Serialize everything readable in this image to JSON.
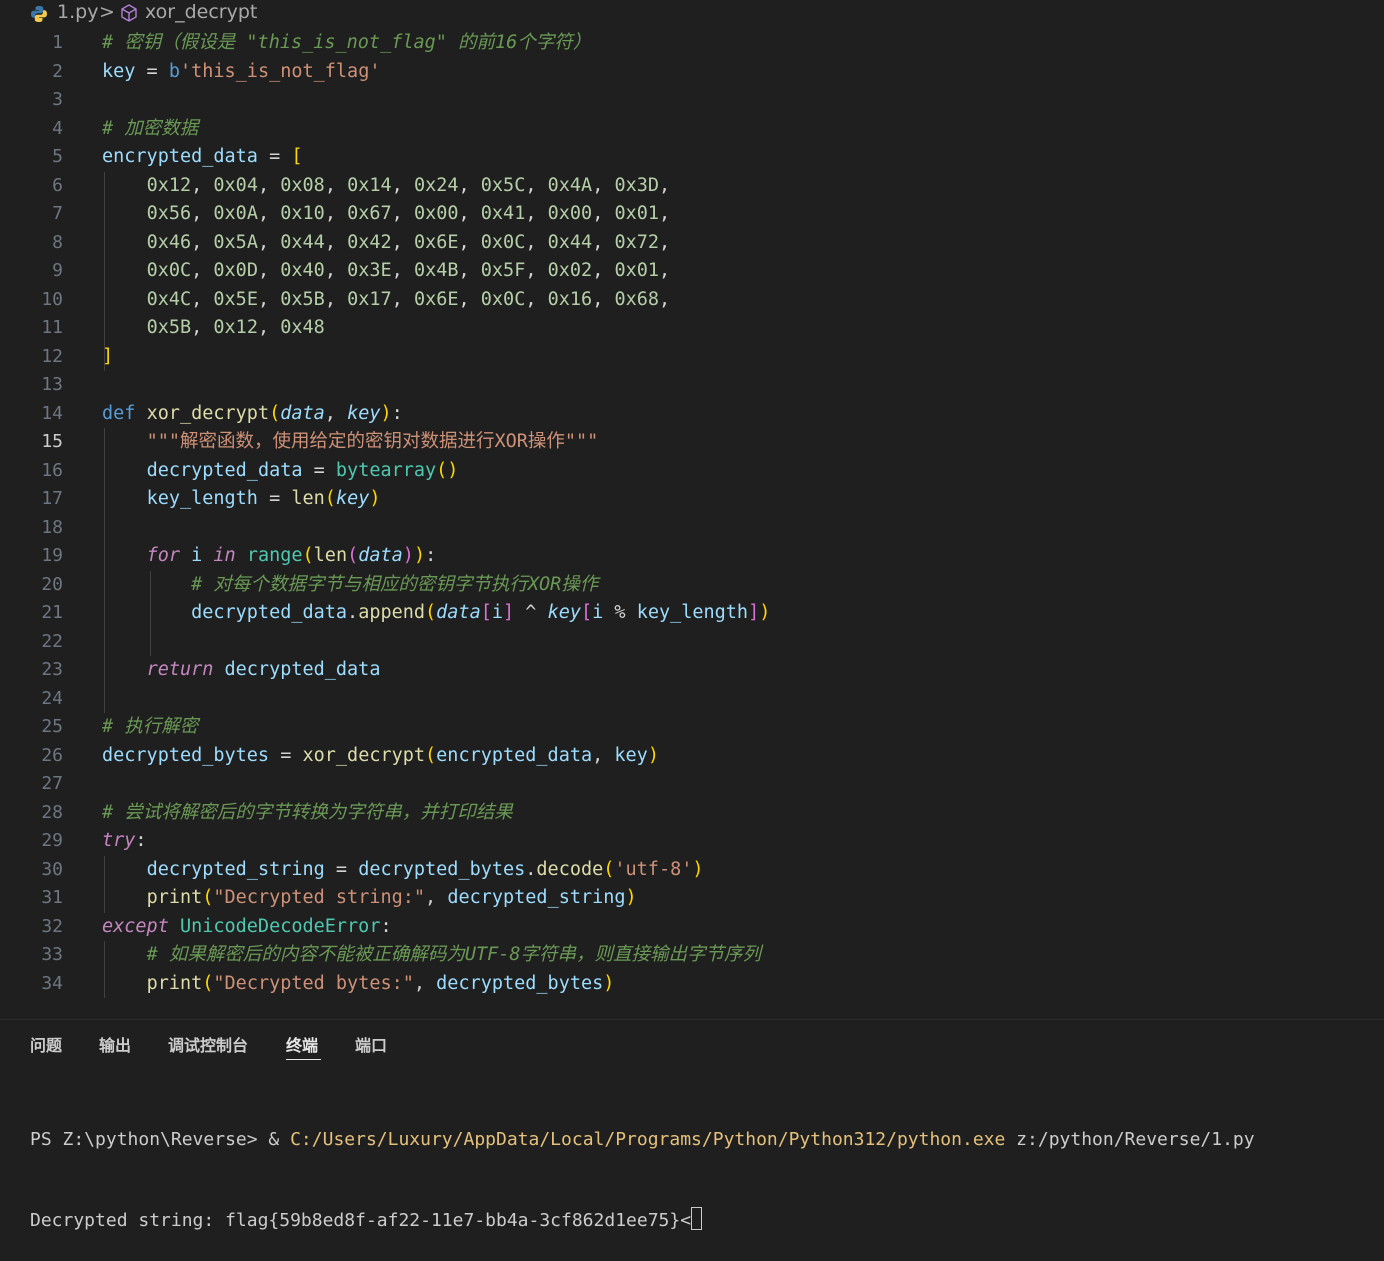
{
  "breadcrumb": {
    "file": "1.py",
    "separator": ">",
    "symbol": "xor_decrypt"
  },
  "editor": {
    "active_line": 15,
    "lines": [
      {
        "n": "1",
        "tokens": [
          [
            "c",
            "# 密钥（假设是 \"this_is_not_flag\" 的前16个字符）"
          ]
        ]
      },
      {
        "n": "2",
        "tokens": [
          [
            "v",
            "key"
          ],
          [
            "op",
            " = "
          ],
          [
            "k",
            "b"
          ],
          [
            "s",
            "'this_is_not_flag'"
          ]
        ]
      },
      {
        "n": "3",
        "tokens": []
      },
      {
        "n": "4",
        "tokens": [
          [
            "c",
            "# 加密数据"
          ]
        ]
      },
      {
        "n": "5",
        "tokens": [
          [
            "v",
            "encrypted_data"
          ],
          [
            "op",
            " = "
          ],
          [
            "b1",
            "["
          ]
        ]
      },
      {
        "n": "6",
        "tokens": [
          [
            "op",
            "    "
          ],
          [
            "n",
            "0x12"
          ],
          [
            "op",
            ", "
          ],
          [
            "n",
            "0x04"
          ],
          [
            "op",
            ", "
          ],
          [
            "n",
            "0x08"
          ],
          [
            "op",
            ", "
          ],
          [
            "n",
            "0x14"
          ],
          [
            "op",
            ", "
          ],
          [
            "n",
            "0x24"
          ],
          [
            "op",
            ", "
          ],
          [
            "n",
            "0x5C"
          ],
          [
            "op",
            ", "
          ],
          [
            "n",
            "0x4A"
          ],
          [
            "op",
            ", "
          ],
          [
            "n",
            "0x3D"
          ],
          [
            "op",
            ","
          ]
        ]
      },
      {
        "n": "7",
        "tokens": [
          [
            "op",
            "    "
          ],
          [
            "n",
            "0x56"
          ],
          [
            "op",
            ", "
          ],
          [
            "n",
            "0x0A"
          ],
          [
            "op",
            ", "
          ],
          [
            "n",
            "0x10"
          ],
          [
            "op",
            ", "
          ],
          [
            "n",
            "0x67"
          ],
          [
            "op",
            ", "
          ],
          [
            "n",
            "0x00"
          ],
          [
            "op",
            ", "
          ],
          [
            "n",
            "0x41"
          ],
          [
            "op",
            ", "
          ],
          [
            "n",
            "0x00"
          ],
          [
            "op",
            ", "
          ],
          [
            "n",
            "0x01"
          ],
          [
            "op",
            ","
          ]
        ]
      },
      {
        "n": "8",
        "tokens": [
          [
            "op",
            "    "
          ],
          [
            "n",
            "0x46"
          ],
          [
            "op",
            ", "
          ],
          [
            "n",
            "0x5A"
          ],
          [
            "op",
            ", "
          ],
          [
            "n",
            "0x44"
          ],
          [
            "op",
            ", "
          ],
          [
            "n",
            "0x42"
          ],
          [
            "op",
            ", "
          ],
          [
            "n",
            "0x6E"
          ],
          [
            "op",
            ", "
          ],
          [
            "n",
            "0x0C"
          ],
          [
            "op",
            ", "
          ],
          [
            "n",
            "0x44"
          ],
          [
            "op",
            ", "
          ],
          [
            "n",
            "0x72"
          ],
          [
            "op",
            ","
          ]
        ]
      },
      {
        "n": "9",
        "tokens": [
          [
            "op",
            "    "
          ],
          [
            "n",
            "0x0C"
          ],
          [
            "op",
            ", "
          ],
          [
            "n",
            "0x0D"
          ],
          [
            "op",
            ", "
          ],
          [
            "n",
            "0x40"
          ],
          [
            "op",
            ", "
          ],
          [
            "n",
            "0x3E"
          ],
          [
            "op",
            ", "
          ],
          [
            "n",
            "0x4B"
          ],
          [
            "op",
            ", "
          ],
          [
            "n",
            "0x5F"
          ],
          [
            "op",
            ", "
          ],
          [
            "n",
            "0x02"
          ],
          [
            "op",
            ", "
          ],
          [
            "n",
            "0x01"
          ],
          [
            "op",
            ","
          ]
        ]
      },
      {
        "n": "10",
        "tokens": [
          [
            "op",
            "    "
          ],
          [
            "n",
            "0x4C"
          ],
          [
            "op",
            ", "
          ],
          [
            "n",
            "0x5E"
          ],
          [
            "op",
            ", "
          ],
          [
            "n",
            "0x5B"
          ],
          [
            "op",
            ", "
          ],
          [
            "n",
            "0x17"
          ],
          [
            "op",
            ", "
          ],
          [
            "n",
            "0x6E"
          ],
          [
            "op",
            ", "
          ],
          [
            "n",
            "0x0C"
          ],
          [
            "op",
            ", "
          ],
          [
            "n",
            "0x16"
          ],
          [
            "op",
            ", "
          ],
          [
            "n",
            "0x68"
          ],
          [
            "op",
            ","
          ]
        ]
      },
      {
        "n": "11",
        "tokens": [
          [
            "op",
            "    "
          ],
          [
            "n",
            "0x5B"
          ],
          [
            "op",
            ", "
          ],
          [
            "n",
            "0x12"
          ],
          [
            "op",
            ", "
          ],
          [
            "n",
            "0x48"
          ]
        ]
      },
      {
        "n": "12",
        "tokens": [
          [
            "b1",
            "]"
          ]
        ]
      },
      {
        "n": "13",
        "tokens": []
      },
      {
        "n": "14",
        "tokens": [
          [
            "k",
            "def"
          ],
          [
            "op",
            " "
          ],
          [
            "f",
            "xor_decrypt"
          ],
          [
            "b1",
            "("
          ],
          [
            "p",
            "data"
          ],
          [
            "op",
            ", "
          ],
          [
            "p",
            "key"
          ],
          [
            "b1",
            ")"
          ],
          [
            "op",
            ":"
          ]
        ]
      },
      {
        "n": "15",
        "tokens": [
          [
            "op",
            "    "
          ],
          [
            "s",
            "\"\"\"解密函数，使用给定的密钥对数据进行XOR操作\"\"\""
          ]
        ]
      },
      {
        "n": "16",
        "tokens": [
          [
            "op",
            "    "
          ],
          [
            "v",
            "decrypted_data"
          ],
          [
            "op",
            " = "
          ],
          [
            "t",
            "bytearray"
          ],
          [
            "b1",
            "()"
          ]
        ]
      },
      {
        "n": "17",
        "tokens": [
          [
            "op",
            "    "
          ],
          [
            "v",
            "key_length"
          ],
          [
            "op",
            " = "
          ],
          [
            "f",
            "len"
          ],
          [
            "b1",
            "("
          ],
          [
            "p",
            "key"
          ],
          [
            "b1",
            ")"
          ]
        ]
      },
      {
        "n": "18",
        "tokens": []
      },
      {
        "n": "19",
        "tokens": [
          [
            "op",
            "    "
          ],
          [
            "kc",
            "for"
          ],
          [
            "op",
            " "
          ],
          [
            "v",
            "i"
          ],
          [
            "op",
            " "
          ],
          [
            "kc",
            "in"
          ],
          [
            "op",
            " "
          ],
          [
            "t",
            "range"
          ],
          [
            "b1",
            "("
          ],
          [
            "f",
            "len"
          ],
          [
            "b2",
            "("
          ],
          [
            "p",
            "data"
          ],
          [
            "b2",
            ")"
          ],
          [
            "b1",
            ")"
          ],
          [
            "op",
            ":"
          ]
        ]
      },
      {
        "n": "20",
        "tokens": [
          [
            "op",
            "        "
          ],
          [
            "c",
            "# 对每个数据字节与相应的密钥字节执行XOR操作"
          ]
        ]
      },
      {
        "n": "21",
        "tokens": [
          [
            "op",
            "        "
          ],
          [
            "v",
            "decrypted_data"
          ],
          [
            "op",
            "."
          ],
          [
            "f",
            "append"
          ],
          [
            "b1",
            "("
          ],
          [
            "p",
            "data"
          ],
          [
            "b2",
            "["
          ],
          [
            "v",
            "i"
          ],
          [
            "b2",
            "]"
          ],
          [
            "op",
            " ^ "
          ],
          [
            "p",
            "key"
          ],
          [
            "b2",
            "["
          ],
          [
            "v",
            "i"
          ],
          [
            "op",
            " % "
          ],
          [
            "v",
            "key_length"
          ],
          [
            "b2",
            "]"
          ],
          [
            "b1",
            ")"
          ]
        ]
      },
      {
        "n": "22",
        "tokens": []
      },
      {
        "n": "23",
        "tokens": [
          [
            "op",
            "    "
          ],
          [
            "kc",
            "return"
          ],
          [
            "op",
            " "
          ],
          [
            "v",
            "decrypted_data"
          ]
        ]
      },
      {
        "n": "24",
        "tokens": []
      },
      {
        "n": "25",
        "tokens": [
          [
            "c",
            "# 执行解密"
          ]
        ]
      },
      {
        "n": "26",
        "tokens": [
          [
            "v",
            "decrypted_bytes"
          ],
          [
            "op",
            " = "
          ],
          [
            "f",
            "xor_decrypt"
          ],
          [
            "b1",
            "("
          ],
          [
            "v",
            "encrypted_data"
          ],
          [
            "op",
            ", "
          ],
          [
            "v",
            "key"
          ],
          [
            "b1",
            ")"
          ]
        ]
      },
      {
        "n": "27",
        "tokens": []
      },
      {
        "n": "28",
        "tokens": [
          [
            "c",
            "# 尝试将解密后的字节转换为字符串，并打印结果"
          ]
        ]
      },
      {
        "n": "29",
        "tokens": [
          [
            "kc",
            "try"
          ],
          [
            "op",
            ":"
          ]
        ]
      },
      {
        "n": "30",
        "tokens": [
          [
            "op",
            "    "
          ],
          [
            "v",
            "decrypted_string"
          ],
          [
            "op",
            " = "
          ],
          [
            "v",
            "decrypted_bytes"
          ],
          [
            "op",
            "."
          ],
          [
            "f",
            "decode"
          ],
          [
            "b1",
            "("
          ],
          [
            "s",
            "'utf-8'"
          ],
          [
            "b1",
            ")"
          ]
        ]
      },
      {
        "n": "31",
        "tokens": [
          [
            "op",
            "    "
          ],
          [
            "f",
            "print"
          ],
          [
            "b1",
            "("
          ],
          [
            "s",
            "\"Decrypted string:\""
          ],
          [
            "op",
            ", "
          ],
          [
            "v",
            "decrypted_string"
          ],
          [
            "b1",
            ")"
          ]
        ]
      },
      {
        "n": "32",
        "tokens": [
          [
            "kc",
            "except"
          ],
          [
            "op",
            " "
          ],
          [
            "t",
            "UnicodeDecodeError"
          ],
          [
            "op",
            ":"
          ]
        ]
      },
      {
        "n": "33",
        "tokens": [
          [
            "op",
            "    "
          ],
          [
            "c",
            "# 如果解密后的内容不能被正确解码为UTF-8字符串，则直接输出字节序列"
          ]
        ]
      },
      {
        "n": "34",
        "tokens": [
          [
            "op",
            "    "
          ],
          [
            "f",
            "print"
          ],
          [
            "b1",
            "("
          ],
          [
            "s",
            "\"Decrypted bytes:\""
          ],
          [
            "op",
            ", "
          ],
          [
            "v",
            "decrypted_bytes"
          ],
          [
            "b1",
            ")"
          ]
        ]
      }
    ]
  },
  "panel": {
    "tabs": [
      "问题",
      "输出",
      "调试控制台",
      "终端",
      "端口"
    ],
    "active_tab": "终端"
  },
  "terminal": {
    "prompt": "PS Z:\\python\\Reverse> & ",
    "exe_path": "C:/Users/Luxury/AppData/Local/Programs/Python/Python312/python.exe",
    "script_arg": " z:/python/Reverse/1.py",
    "output": "Decrypted string: flag{59b8ed8f-af22-11e7-bb4a-3cf862d1ee75}<"
  },
  "colors": {
    "background": "#1f1f1f",
    "keyword": "#569cd6",
    "control_keyword": "#c586c0",
    "function": "#dcdcaa",
    "variable": "#9cdcfe",
    "string": "#ce9178",
    "number": "#b5cea8",
    "comment": "#6a9955",
    "type": "#4ec9b0"
  }
}
